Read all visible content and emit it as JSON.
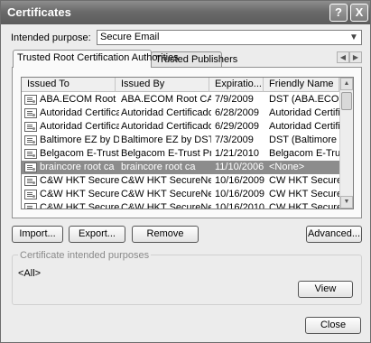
{
  "window": {
    "title": "Certificates"
  },
  "titlebar_buttons": {
    "help": "?",
    "close": "X"
  },
  "purpose": {
    "label": "Intended purpose:",
    "value": "Secure Email"
  },
  "tabs": [
    {
      "label": "Trusted Root Certification Authorities",
      "active": true
    },
    {
      "label": "Trusted Publishers",
      "active": false
    }
  ],
  "tab_scroll": {
    "left": "◀",
    "right": "▶"
  },
  "list": {
    "columns": [
      "Issued To",
      "Issued By",
      "Expiratio...",
      "Friendly Name"
    ],
    "rows": [
      {
        "issued_to": "ABA.ECOM Root CA",
        "issued_by": "ABA.ECOM Root CA",
        "expiration": "7/9/2009",
        "friendly": "DST (ABA.ECOM...",
        "selected": false
      },
      {
        "issued_to": "Autoridad Certifica...",
        "issued_by": "Autoridad Certificador...",
        "expiration": "6/28/2009",
        "friendly": "Autoridad Certifi...",
        "selected": false
      },
      {
        "issued_to": "Autoridad Certifica...",
        "issued_by": "Autoridad Certificador...",
        "expiration": "6/29/2009",
        "friendly": "Autoridad Certifi...",
        "selected": false
      },
      {
        "issued_to": "Baltimore EZ by DST",
        "issued_by": "Baltimore EZ by DST",
        "expiration": "7/3/2009",
        "friendly": "DST (Baltimore E...",
        "selected": false
      },
      {
        "issued_to": "Belgacom E-Trust P...",
        "issued_by": "Belgacom E-Trust Prim...",
        "expiration": "1/21/2010",
        "friendly": "Belgacom E-Trus...",
        "selected": false
      },
      {
        "issued_to": "braincore root ca",
        "issued_by": "braincore root ca",
        "expiration": "11/10/2006",
        "friendly": "<None>",
        "selected": true
      },
      {
        "issued_to": "C&W HKT SecureN...",
        "issued_by": "C&W HKT SecureNet ...",
        "expiration": "10/16/2009",
        "friendly": "CW HKT Secure...",
        "selected": false
      },
      {
        "issued_to": "C&W HKT SecureN...",
        "issued_by": "C&W HKT SecureNet ...",
        "expiration": "10/16/2009",
        "friendly": "CW HKT Secure...",
        "selected": false
      },
      {
        "issued_to": "C&W HKT SecureN...",
        "issued_by": "C&W HKT SecureNet ...",
        "expiration": "10/16/2010",
        "friendly": "CW HKT Secure...",
        "selected": false
      }
    ]
  },
  "buttons": {
    "import": "Import...",
    "export": "Export...",
    "remove": "Remove",
    "advanced": "Advanced...",
    "view": "View",
    "close": "Close"
  },
  "intended_purposes": {
    "title": "Certificate intended purposes",
    "value": "<All>"
  },
  "icons": {
    "certificate": "certificate-icon",
    "dropdown": "chevron-down-icon",
    "scroll_up": "scroll-up-icon",
    "scroll_down": "scroll-down-icon"
  }
}
